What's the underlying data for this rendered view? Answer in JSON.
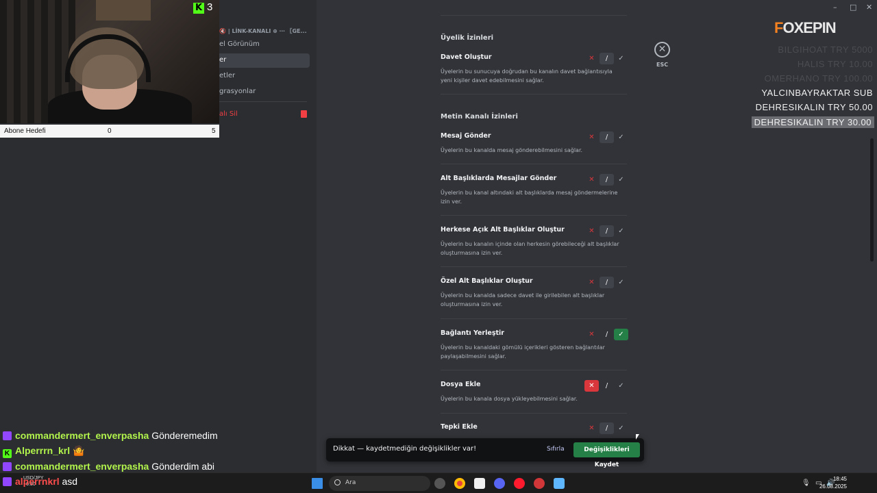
{
  "window": {
    "controls": [
      "–",
      "□",
      "✕"
    ]
  },
  "webcam": {
    "kick_count": "3",
    "kick_letter": "K"
  },
  "sub_goal": {
    "label": "Abone Hedefi",
    "current": "0",
    "target": "5"
  },
  "sidebar": {
    "channel_title": "🔇 | LİNK-KANALI ⊕ ⋯ 〖GE...",
    "items": [
      {
        "label": "el Görünüm",
        "active": false
      },
      {
        "label": "er",
        "active": true
      },
      {
        "label": "etler",
        "active": false
      },
      {
        "label": "grasyonlar",
        "active": false
      },
      {
        "label": "alı Sil",
        "danger": true
      }
    ]
  },
  "esc": {
    "icon": "✕",
    "label": "ESC"
  },
  "overlay": {
    "logo_accent": "F",
    "logo_text": "OXEPIN",
    "donations": [
      {
        "text": "BILGIHOAT TRY 5000",
        "state": "faded"
      },
      {
        "text": "HALIS TRY 10.00",
        "state": "faded"
      },
      {
        "text": "OMERHANO TRY 100.00",
        "state": "faded"
      },
      {
        "text": "YALCINBAYRAKTAR SUB",
        "state": "normal"
      },
      {
        "text": "DEHRESIKALIN TRY 50.00",
        "state": "normal"
      },
      {
        "text": "DEHRESIKALIN TRY 30.00",
        "state": "highlight"
      }
    ]
  },
  "permissions": {
    "section1": "Üyelik İzinleri",
    "section2": "Metin Kanalı İzinleri",
    "items": [
      {
        "name": "Davet Oluştur",
        "desc": "Üyelerin bu sunucuya doğrudan bu kanalın davet bağlantısıyla yeni kişiler davet edebilmesini sağlar.",
        "state": "neutral"
      },
      {
        "name": "Mesaj Gönder",
        "desc": "Üyelerin bu kanalda mesaj gönderebilmesini sağlar.",
        "state": "neutral"
      },
      {
        "name": "Alt Başlıklarda Mesajlar Gönder",
        "desc": "Üyelerin bu kanal altındaki alt başlıklarda mesaj göndermelerine izin ver.",
        "state": "neutral"
      },
      {
        "name": "Herkese Açık Alt Başlıklar Oluştur",
        "desc": "Üyelerin bu kanalın içinde olan herkesin görebileceği alt başlıklar oluşturmasına izin ver.",
        "state": "neutral"
      },
      {
        "name": "Özel Alt Başlıklar Oluştur",
        "desc": "Üyelerin bu kanalda sadece davet ile girilebilen alt başlıklar oluşturmasına izin ver.",
        "state": "neutral"
      },
      {
        "name": "Bağlantı Yerleştir",
        "desc": "Üyelerin bu kanaldaki gömülü içerikleri gösteren bağlantılar paylaşabilmesini sağlar.",
        "state": "allow"
      },
      {
        "name": "Dosya Ekle",
        "desc": "Üyelerin bu kanala dosya yükleyebilmesini sağlar.",
        "state": "deny"
      },
      {
        "name": "Tepki Ekle",
        "desc": "",
        "state": "neutral"
      }
    ],
    "deny_glyph": "✕",
    "neutral_glyph": "/",
    "allow_glyph": "✓"
  },
  "savebar": {
    "message": "Dikkat — kaydetmediğin değişiklikler var!",
    "reset": "Sıfırla",
    "save": "Değişiklikleri Kaydet"
  },
  "chat": [
    {
      "platform": "twitch",
      "user": "commandermert_enverpasha",
      "msg": "Gönderemedim"
    },
    {
      "platform": "kick",
      "user": "Alperrrn_krl",
      "msg": "🤷"
    },
    {
      "platform": "twitch",
      "user": "commandermert_enverpasha",
      "msg": "Gönderdim abi"
    },
    {
      "platform": "twitch",
      "user": "alperrnkrl",
      "msg": "asd"
    }
  ],
  "taskbar": {
    "ticker_symbol": "USD/JPY",
    "ticker_value": "+0.30",
    "search_placeholder": "Ara",
    "time": "18:45",
    "date": "26.08.2025"
  }
}
